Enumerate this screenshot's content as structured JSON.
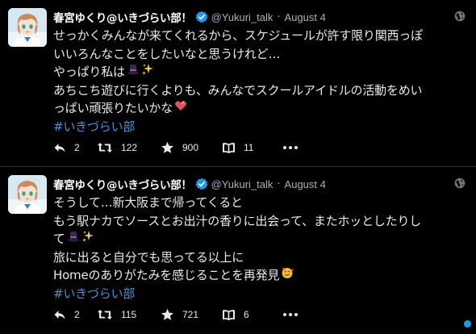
{
  "colors": {
    "background": "#000000",
    "text": "#e7e9ea",
    "muted": "#a9b1b8",
    "hashtag": "#4d8fd1",
    "verified": "#1d9bf0",
    "unread": "#1d9bf0"
  },
  "tweets": [
    {
      "display_name": "春宮ゆくり@いきづらい部！",
      "handle": "@Yukuri_talk",
      "separator": "·",
      "date": "August 4",
      "lines": [
        "せっかくみんなが来てくれるから、スケジュールが許す限り関西っぽ",
        "いいろんなことをしたいなと思うけれど…",
        "やっぱり私は",
        "あちこち遊びに行くよりも、みんなでスクールアイドルの活動をめい",
        "っぱい頑張りたいかな"
      ],
      "hashtag": "#いきづらい部",
      "counts": {
        "replies": "2",
        "retweets": "122",
        "likes": "900",
        "bookmarks": "11"
      }
    },
    {
      "display_name": "春宮ゆくり@いきづらい部！",
      "handle": "@Yukuri_talk",
      "separator": "·",
      "date": "August 4",
      "lines": [
        "そうして…新大阪まで帰ってくると",
        "もう駅ナカでソースとお出汁の香りに出会って、またホッとしたりし",
        "て",
        "旅に出ると自分でも思ってる以上に",
        "Homeのありがたみを感じることを再発見"
      ],
      "hashtag": "#いきづらい部",
      "counts": {
        "replies": "2",
        "retweets": "115",
        "likes": "721",
        "bookmarks": "6"
      }
    }
  ],
  "icons": {
    "verified": "verified-badge-icon",
    "globe": "globe-icon",
    "reply": "reply-icon",
    "retweet": "retweet-icon",
    "like": "star-icon",
    "bookmark": "book-icon",
    "more": "more-dots-icon",
    "hat": "top-hat-emoji",
    "sparkles": "sparkles-emoji",
    "heart": "heart-emoji",
    "smile": "smiling-hearts-emoji"
  }
}
